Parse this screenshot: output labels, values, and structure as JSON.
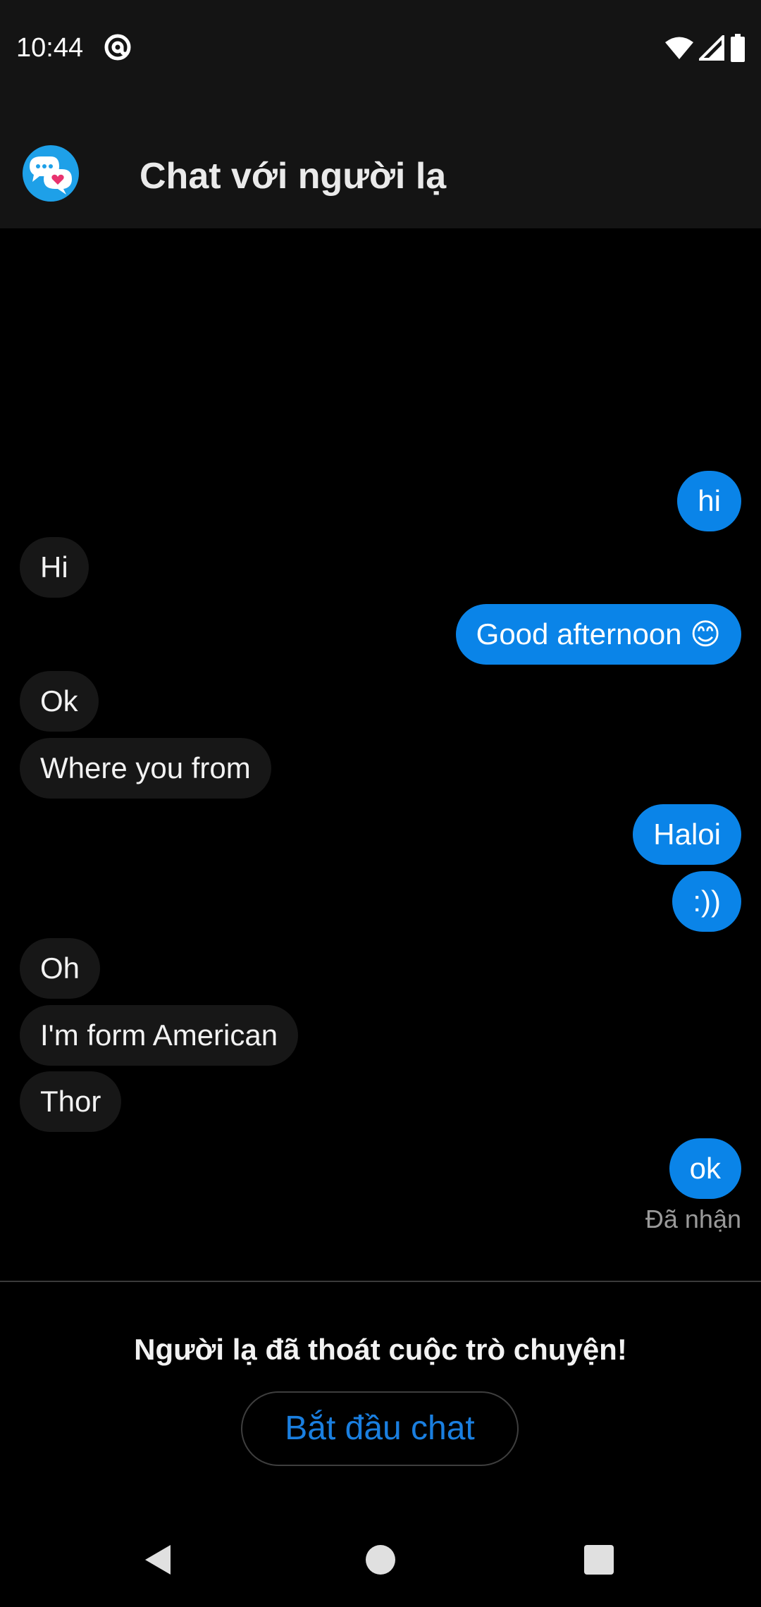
{
  "status_bar": {
    "time": "10:44",
    "icons": [
      "at-sign-icon",
      "wifi-icon",
      "signal-icon",
      "battery-icon"
    ]
  },
  "app_bar": {
    "title": "Chat với người lạ",
    "logo_icon": "chat-bubbles-heart-icon"
  },
  "messages": [
    {
      "side": "out",
      "text": "hi"
    },
    {
      "side": "in",
      "text": "Hi"
    },
    {
      "side": "out",
      "text": "Good afternoon 😊"
    },
    {
      "side": "in",
      "text": "Ok"
    },
    {
      "side": "in",
      "text": "Where you from"
    },
    {
      "side": "out",
      "text": "Haloi"
    },
    {
      "side": "out",
      "text": ":))"
    },
    {
      "side": "in",
      "text": "Oh"
    },
    {
      "side": "in",
      "text": "I'm form American"
    },
    {
      "side": "in",
      "text": "Thor"
    },
    {
      "side": "out",
      "text": "ok"
    }
  ],
  "delivery_status": "Đã nhận",
  "ended_notice": "Người lạ đã thoát cuộc trò chuyện!",
  "start_chat_label": "Bắt đầu chat",
  "colors": {
    "outgoing_bubble": "#0a84e8",
    "incoming_bubble": "#171717",
    "accent_text": "#1a7fe0",
    "background": "#000000",
    "bar_background": "#141414"
  },
  "nav_bar": {
    "icons": [
      "back-icon",
      "home-icon",
      "recents-icon"
    ]
  }
}
